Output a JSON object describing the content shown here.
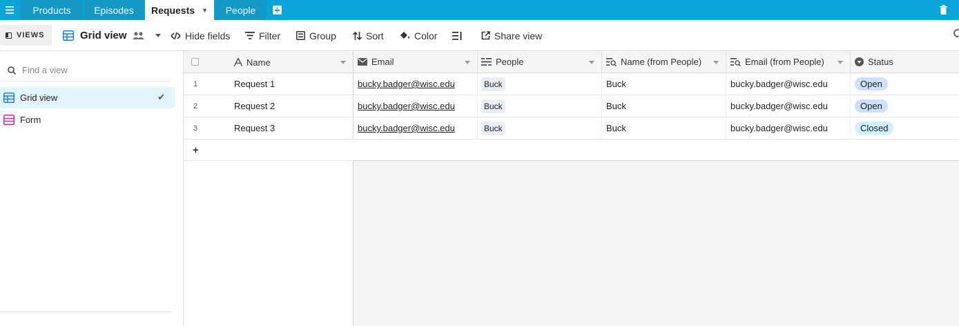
{
  "tabs": [
    {
      "label": "Products",
      "active": false
    },
    {
      "label": "Episodes",
      "active": false
    },
    {
      "label": "Requests",
      "active": true
    },
    {
      "label": "People",
      "active": false
    }
  ],
  "toolbar": {
    "views_label": "VIEWS",
    "current_view": "Grid view",
    "hide_fields": "Hide fields",
    "filter": "Filter",
    "group": "Group",
    "sort": "Sort",
    "color": "Color",
    "share_view": "Share view"
  },
  "sidebar": {
    "find_placeholder": "Find a view",
    "views": [
      {
        "label": "Grid view",
        "selected": true
      },
      {
        "label": "Form",
        "selected": false
      }
    ]
  },
  "table": {
    "columns": [
      "Name",
      "Email",
      "People",
      "Name (from People)",
      "Email (from People)",
      "Status"
    ],
    "rows": [
      {
        "num": "1",
        "name": "Request 1",
        "email": "bucky.badger@wisc.edu",
        "people": "Buck",
        "name_from_people": "Buck",
        "email_from_people": "bucky.badger@wisc.edu",
        "status": "Open"
      },
      {
        "num": "2",
        "name": "Request 2",
        "email": "bucky.badger@wisc.edu",
        "people": "Buck",
        "name_from_people": "Buck",
        "email_from_people": "bucky.badger@wisc.edu",
        "status": "Open"
      },
      {
        "num": "3",
        "name": "Request 3",
        "email": "bucky.badger@wisc.edu",
        "people": "Buck",
        "name_from_people": "Buck",
        "email_from_people": "bucky.badger@wisc.edu",
        "status": "Closed"
      }
    ],
    "add_row_label": "+"
  },
  "colors": {
    "tabbar": "#0aa3d6",
    "status_open": "#cfdfff",
    "status_closed": "#d0f0fd",
    "grid_view_icon": "#1283da",
    "form_icon": "#e91e9b"
  }
}
